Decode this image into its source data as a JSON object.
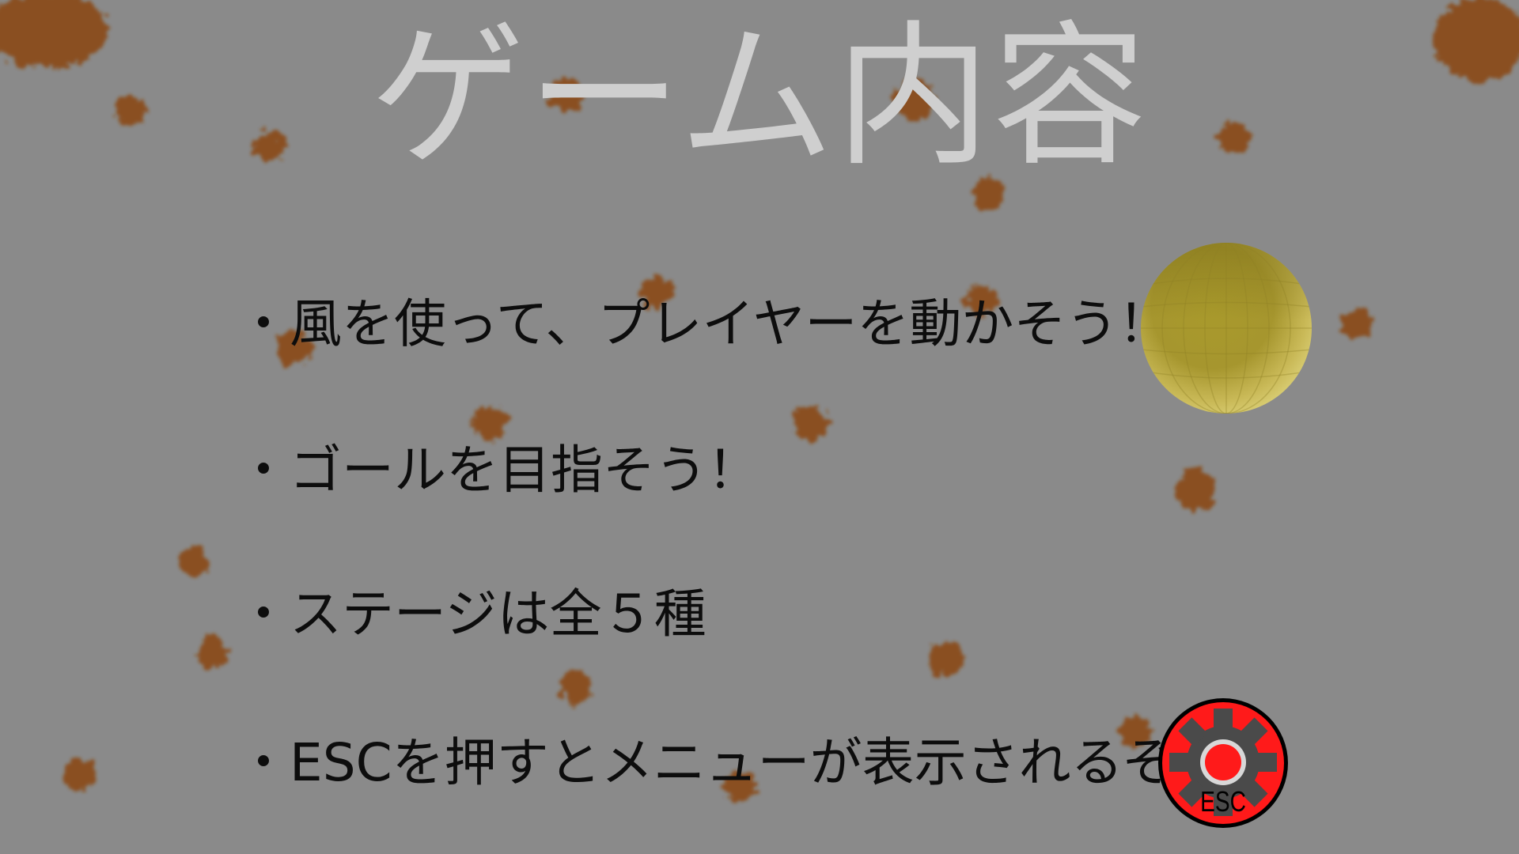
{
  "screen": {
    "title": "ゲーム内容",
    "background_color": "#8a8a8a",
    "blot_color": "#8a4a12",
    "instructions": [
      "・風を使って、プレイヤーを動かそう！→",
      "・ゴールを目指そう！",
      "・ステージは全５種",
      "・ESCを押すとメニューが表示されるぞ→"
    ]
  },
  "icons": {
    "player": "player-ball-icon",
    "menu": "esc-gear-icon",
    "menu_label": "ESC",
    "menu_color": "#ff1a1a"
  }
}
